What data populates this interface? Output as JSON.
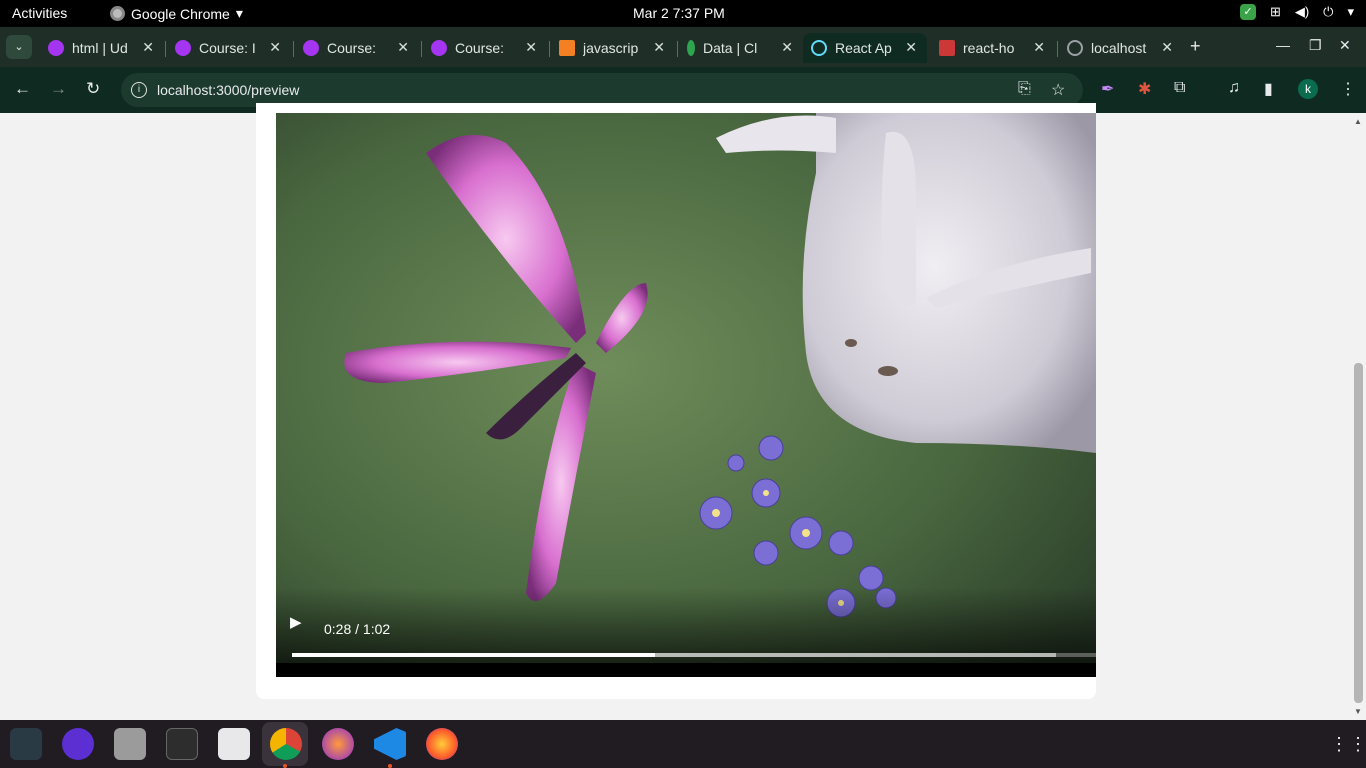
{
  "system_bar": {
    "activities": "Activities",
    "app_name": "Google Chrome",
    "clock": "Mar 2  7:37 PM"
  },
  "tabs": [
    {
      "title": "html | Ud",
      "favicon_color": "#a435f0"
    },
    {
      "title": "Course: I",
      "favicon_color": "#a435f0"
    },
    {
      "title": "Course: ",
      "favicon_color": "#a435f0"
    },
    {
      "title": "Course: ",
      "favicon_color": "#a435f0"
    },
    {
      "title": "javascrip",
      "favicon_color": "#f48024"
    },
    {
      "title": "Data | Cl",
      "favicon_color": "#2ea44f"
    },
    {
      "title": "React Ap",
      "favicon_color": "#61dafb",
      "active": true
    },
    {
      "title": "react-ho",
      "favicon_color": "#cb3837"
    },
    {
      "title": "localhost",
      "favicon_color": "#9aa0a6"
    }
  ],
  "toolbar": {
    "url": "localhost:3000/preview",
    "avatar_letter": "k"
  },
  "video": {
    "time_display": "0:28 / 1:02",
    "played_fraction": 0.4516,
    "buffered_fraction": 0.95
  },
  "dock": {
    "apps": [
      "system-monitor",
      "screen-recorder",
      "files",
      "terminal",
      "text-editor",
      "google-chrome",
      "firefox-dev",
      "vscode",
      "firefox"
    ]
  }
}
